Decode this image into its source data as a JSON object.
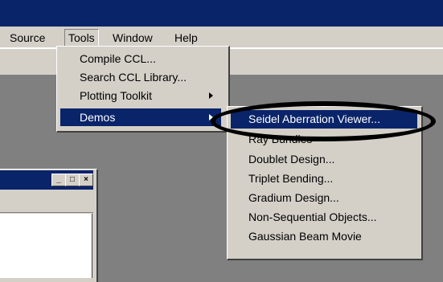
{
  "menubar": {
    "items": [
      "Source",
      "Tools",
      "Window",
      "Help"
    ]
  },
  "tools_menu": {
    "items": [
      {
        "label": "Compile CCL...",
        "has_submenu": false
      },
      {
        "label": "Search CCL Library...",
        "has_submenu": false
      },
      {
        "label": "Plotting Toolkit",
        "has_submenu": true
      },
      {
        "label": "Demos",
        "has_submenu": true,
        "selected": true
      }
    ]
  },
  "demos_menu": {
    "items": [
      {
        "label": "Seidel Aberration Viewer...",
        "selected": true
      },
      {
        "label": "Ray Bundles"
      },
      {
        "label": "Doublet Design..."
      },
      {
        "label": "Triplet Bending..."
      },
      {
        "label": "Gradium Design..."
      },
      {
        "label": "Non-Sequential Objects..."
      },
      {
        "label": "Gaussian Beam Movie"
      }
    ]
  },
  "child_window": {
    "caption_buttons": [
      "_",
      "□",
      "×"
    ]
  },
  "colors": {
    "face": "#d4d0c8",
    "selection": "#0a246a",
    "workspace": "#808080"
  }
}
